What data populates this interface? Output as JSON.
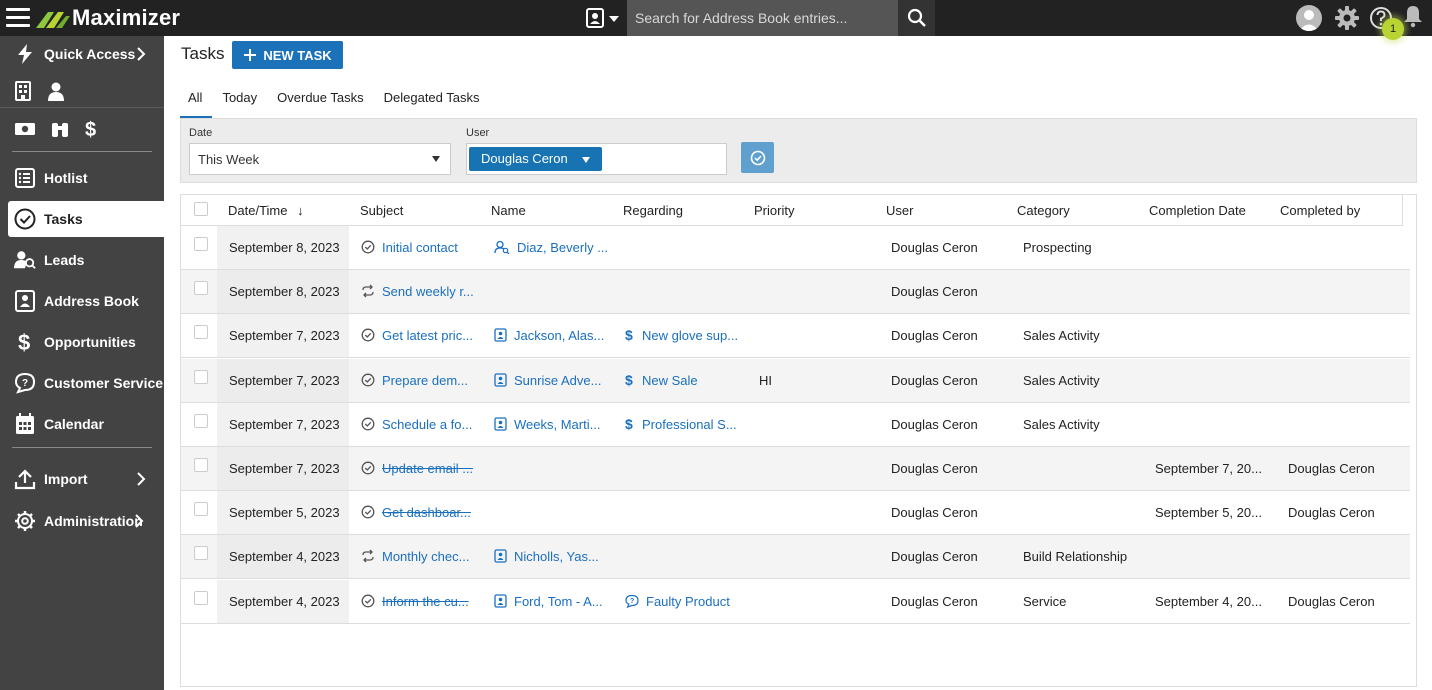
{
  "app": {
    "name": "Maximizer"
  },
  "search": {
    "placeholder": "Search for Address Book entries..."
  },
  "notifications": {
    "count": "1"
  },
  "sidebar": {
    "items": [
      {
        "label": "Quick Access"
      },
      {
        "label": "Hotlist"
      },
      {
        "label": "Tasks"
      },
      {
        "label": "Leads"
      },
      {
        "label": "Address Book"
      },
      {
        "label": "Opportunities"
      },
      {
        "label": "Customer Service"
      },
      {
        "label": "Calendar"
      },
      {
        "label": "Import"
      },
      {
        "label": "Administration"
      }
    ]
  },
  "page": {
    "title": "Tasks",
    "new_task_label": "NEW TASK"
  },
  "tabs": [
    {
      "label": "All"
    },
    {
      "label": "Today"
    },
    {
      "label": "Overdue Tasks"
    },
    {
      "label": "Delegated Tasks"
    }
  ],
  "filters": {
    "date_label": "Date",
    "date_value": "This Week",
    "user_label": "User",
    "user_value": "Douglas Ceron"
  },
  "table": {
    "columns": [
      "Date/Time",
      "Subject",
      "Name",
      "Regarding",
      "Priority",
      "User",
      "Category",
      "Completion Date",
      "Completed by"
    ],
    "sort_indicator": "↓",
    "rows": [
      {
        "date": "September 8, 2023",
        "subject": "Initial contact",
        "subject_icon": "check-circle-icon",
        "name": "Diaz, Beverly ...",
        "name_icon": "lead-person-icon",
        "regarding": "",
        "regarding_icon": "",
        "priority": "",
        "user": "Douglas Ceron",
        "category": "Prospecting",
        "completion_date": "",
        "completed_by": "",
        "completed": false
      },
      {
        "date": "September 8, 2023",
        "subject": "Send weekly r...",
        "subject_icon": "recurring-icon",
        "name": "",
        "name_icon": "",
        "regarding": "",
        "regarding_icon": "",
        "priority": "",
        "user": "Douglas Ceron",
        "category": "",
        "completion_date": "",
        "completed_by": "",
        "completed": false
      },
      {
        "date": "September 7, 2023",
        "subject": "Get latest pric...",
        "subject_icon": "check-circle-icon",
        "name": "Jackson, Alas...",
        "name_icon": "address-book-icon",
        "regarding": "New glove sup...",
        "regarding_icon": "dollar-icon",
        "priority": "",
        "user": "Douglas Ceron",
        "category": "Sales Activity",
        "completion_date": "",
        "completed_by": "",
        "completed": false
      },
      {
        "date": "September 7, 2023",
        "subject": "Prepare dem...",
        "subject_icon": "check-circle-icon",
        "name": "Sunrise Adve...",
        "name_icon": "address-book-icon",
        "regarding": "New Sale",
        "regarding_icon": "dollar-icon",
        "priority": "HI",
        "user": "Douglas Ceron",
        "category": "Sales Activity",
        "completion_date": "",
        "completed_by": "",
        "completed": false
      },
      {
        "date": "September 7, 2023",
        "subject": "Schedule a fo...",
        "subject_icon": "check-circle-icon",
        "name": "Weeks, Marti...",
        "name_icon": "address-book-icon",
        "regarding": "Professional S...",
        "regarding_icon": "dollar-icon",
        "priority": "",
        "user": "Douglas Ceron",
        "category": "Sales Activity",
        "completion_date": "",
        "completed_by": "",
        "completed": false
      },
      {
        "date": "September 7, 2023",
        "subject": "Update email ...",
        "subject_icon": "check-circle-icon",
        "name": "",
        "name_icon": "",
        "regarding": "",
        "regarding_icon": "",
        "priority": "",
        "user": "Douglas Ceron",
        "category": "",
        "completion_date": "September 7, 20...",
        "completed_by": "Douglas Ceron",
        "completed": true
      },
      {
        "date": "September 5, 2023",
        "subject": "Get dashboar...",
        "subject_icon": "check-circle-icon",
        "name": "",
        "name_icon": "",
        "regarding": "",
        "regarding_icon": "",
        "priority": "",
        "user": "Douglas Ceron",
        "category": "",
        "completion_date": "September 5, 20...",
        "completed_by": "Douglas Ceron",
        "completed": true
      },
      {
        "date": "September 4, 2023",
        "subject": "Monthly chec...",
        "subject_icon": "recurring-icon",
        "name": "Nicholls, Yas...",
        "name_icon": "address-book-icon",
        "regarding": "",
        "regarding_icon": "",
        "priority": "",
        "user": "Douglas Ceron",
        "category": "Build Relationship",
        "completion_date": "",
        "completed_by": "",
        "completed": false
      },
      {
        "date": "September 4, 2023",
        "subject": "Inform the cu...",
        "subject_icon": "check-circle-icon",
        "name": "Ford, Tom - A...",
        "name_icon": "address-book-icon",
        "regarding": "Faulty Product",
        "regarding_icon": "service-case-icon",
        "priority": "",
        "user": "Douglas Ceron",
        "category": "Service",
        "completion_date": "September 4, 20...",
        "completed_by": "Douglas Ceron",
        "completed": true
      }
    ]
  },
  "colors": {
    "topbar": "#222222",
    "sidebar": "#434343",
    "accent": "#1c72b8",
    "link": "#1a6fbf",
    "badge": "#b7d432"
  }
}
